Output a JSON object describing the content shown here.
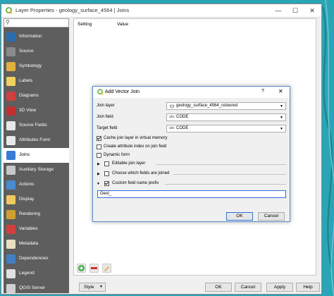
{
  "window": {
    "title": "Layer Properties - geology_surface_4564 | Joins",
    "minimize": "—",
    "maximize": "☐",
    "close": "✕"
  },
  "sidebar": {
    "search_icon": "search-icon",
    "items": [
      {
        "label": "Information",
        "icon": "information-icon",
        "color": "#2b6cb0"
      },
      {
        "label": "Source",
        "icon": "source-icon",
        "color": "#8a8a8a"
      },
      {
        "label": "Symbology",
        "icon": "symbology-icon",
        "color": "#e0b040"
      },
      {
        "label": "Labels",
        "icon": "labels-icon",
        "color": "#f0d060"
      },
      {
        "label": "Diagrams",
        "icon": "diagrams-icon",
        "color": "#d04040"
      },
      {
        "label": "3D View",
        "icon": "3d-view-icon",
        "color": "#c03030"
      },
      {
        "label": "Source Fields",
        "icon": "source-fields-icon",
        "color": "#e8e8e8"
      },
      {
        "label": "Attributes Form",
        "icon": "attributes-form-icon",
        "color": "#e8e8e8"
      },
      {
        "label": "Joins",
        "icon": "joins-icon",
        "color": "#3a7ad8"
      },
      {
        "label": "Auxiliary Storage",
        "icon": "auxiliary-storage-icon",
        "color": "#c8c8c8"
      },
      {
        "label": "Actions",
        "icon": "actions-icon",
        "color": "#4a8ad0"
      },
      {
        "label": "Display",
        "icon": "display-icon",
        "color": "#f0c860"
      },
      {
        "label": "Rendering",
        "icon": "rendering-icon",
        "color": "#d0a030"
      },
      {
        "label": "Variables",
        "icon": "variables-icon",
        "color": "#d04040"
      },
      {
        "label": "Metadata",
        "icon": "metadata-icon",
        "color": "#e8e0c0"
      },
      {
        "label": "Dependencies",
        "icon": "dependencies-icon",
        "color": "#4080c0"
      },
      {
        "label": "Legend",
        "icon": "legend-icon",
        "color": "#e0e0e0"
      },
      {
        "label": "QGIS Server",
        "icon": "qgis-server-icon",
        "color": "#d0d0d0"
      }
    ],
    "active_index": 8
  },
  "table": {
    "col_setting": "Setting",
    "col_value": "Value"
  },
  "footer": {
    "style_label": "Style",
    "ok": "OK",
    "cancel": "Cancel",
    "apply": "Apply",
    "help": "Help"
  },
  "dialog": {
    "title": "Add Vector Join",
    "help": "?",
    "close": "✕",
    "join_layer_label": "Join layer",
    "join_layer_value": "geology_surface_4564_coloured",
    "join_field_label": "Join field",
    "join_field_value": "CODE",
    "target_field_label": "Target field",
    "target_field_value": "CODE",
    "field_type_badge": "abc",
    "cache_label": "Cache join layer in virtual memory",
    "cache_checked": true,
    "index_label": "Create attribute index on join field",
    "index_checked": false,
    "dynamic_label": "Dynamic form",
    "dynamic_checked": false,
    "editable_label": "Editable join layer",
    "editable_checked": false,
    "choose_label": "Choose which fields are joined",
    "choose_checked": false,
    "prefix_label": "Custom field name prefix",
    "prefix_checked": true,
    "prefix_value": "Geol_",
    "ok": "OK",
    "cancel": "Cancel"
  },
  "colors": {
    "sidebar_bg": "#5e5e5e",
    "accent": "#2e6fd6",
    "background": "#2aa5b5"
  }
}
